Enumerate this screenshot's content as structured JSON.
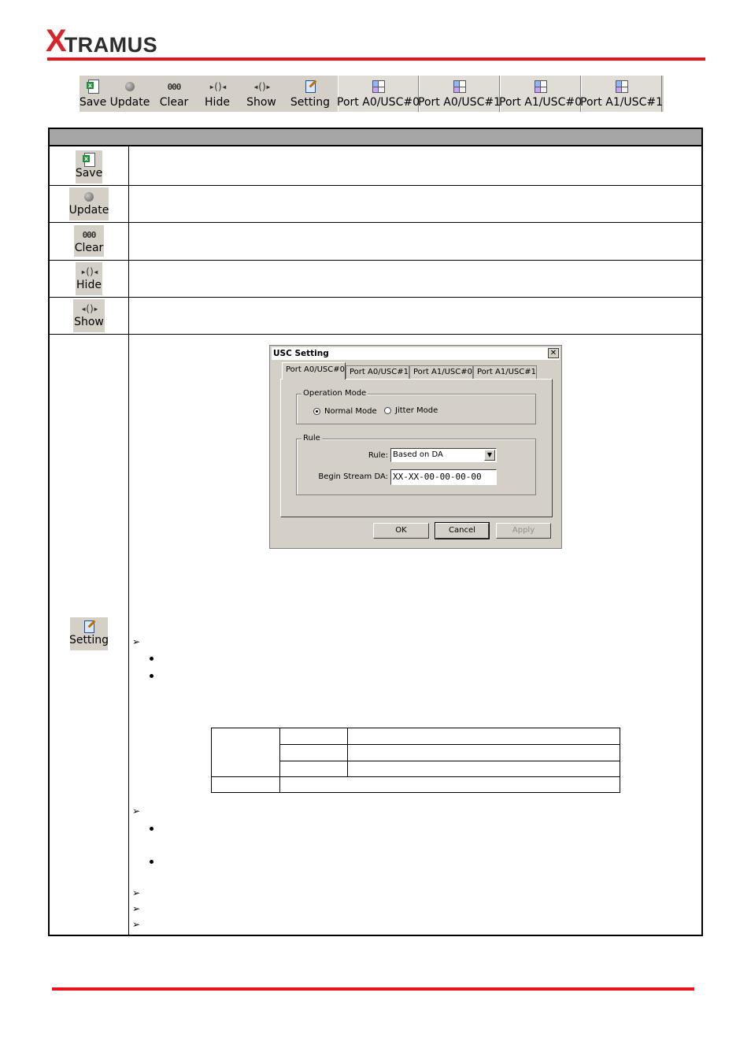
{
  "header": {
    "logo_x": "X",
    "logo_rest": "TRAMUS"
  },
  "toolbar": {
    "buttons": [
      {
        "label": "Save",
        "icon": "save-excel-icon"
      },
      {
        "label": "Update",
        "icon": "update-dot-icon"
      },
      {
        "label": "Clear",
        "icon": "clear-icon"
      },
      {
        "label": "Hide",
        "icon": "hide-icon"
      },
      {
        "label": "Show",
        "icon": "show-icon"
      },
      {
        "label": "Setting",
        "icon": "setting-icon"
      }
    ],
    "ports": [
      {
        "label": "Port A0/USC#0",
        "icon": "port-grid-icon"
      },
      {
        "label": "Port A0/USC#1",
        "icon": "port-grid-icon"
      },
      {
        "label": "Port A1/USC#0",
        "icon": "port-grid-icon"
      },
      {
        "label": "Port A1/USC#1",
        "icon": "port-grid-icon"
      }
    ]
  },
  "rows": {
    "save": "Save",
    "update": "Update",
    "clear": "Clear",
    "hide": "Hide",
    "show": "Show",
    "setting": "Setting"
  },
  "dialog": {
    "title": "USC Setting",
    "close": "✕",
    "tabs": [
      "Port A0/USC#0",
      "Port A0/USC#1",
      "Port A1/USC#0",
      "Port A1/USC#1"
    ],
    "operation_mode": {
      "title": "Operation Mode",
      "normal": "Normal Mode",
      "jitter": "Jitter Mode",
      "selected": "Normal Mode"
    },
    "rule": {
      "title": "Rule",
      "rule_label": "Rule:",
      "rule_value": "Based on DA",
      "begin_label": "Begin Stream DA:",
      "begin_value": "XX-XX-00-00-00-00"
    },
    "buttons": {
      "ok": "OK",
      "cancel": "Cancel",
      "apply": "Apply"
    }
  },
  "colors": {
    "brand_red": "#e8141c",
    "header_gray": "#a6a6a6",
    "win_face": "#d4d0c8"
  }
}
